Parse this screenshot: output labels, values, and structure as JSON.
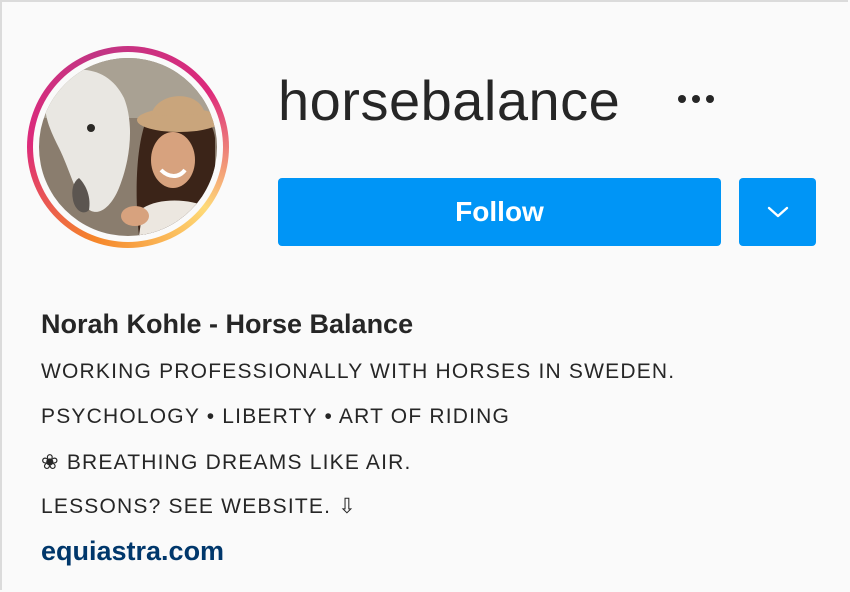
{
  "profile": {
    "username": "horsebalance",
    "more_icon": "more-horizontal-icon",
    "follow_label": "Follow",
    "dropdown_icon": "chevron-down-icon",
    "full_name": "Norah Kohle - Horse Balance",
    "bio": [
      "WORKING PROFESSIONALLY WITH HORSES IN SWEDEN.",
      "PSYCHOLOGY • LIBERTY • ART OF RIDING",
      "❀ BREATHING DREAMS LIKE AIR.",
      "LESSONS? SEE WEBSITE. ⇩"
    ],
    "website": "equiastra.com"
  },
  "colors": {
    "follow_button": "#0095f6",
    "link": "#00376b",
    "text": "#262626",
    "story_ring": [
      "#f58529",
      "#dd2a7b",
      "#c13584"
    ]
  }
}
